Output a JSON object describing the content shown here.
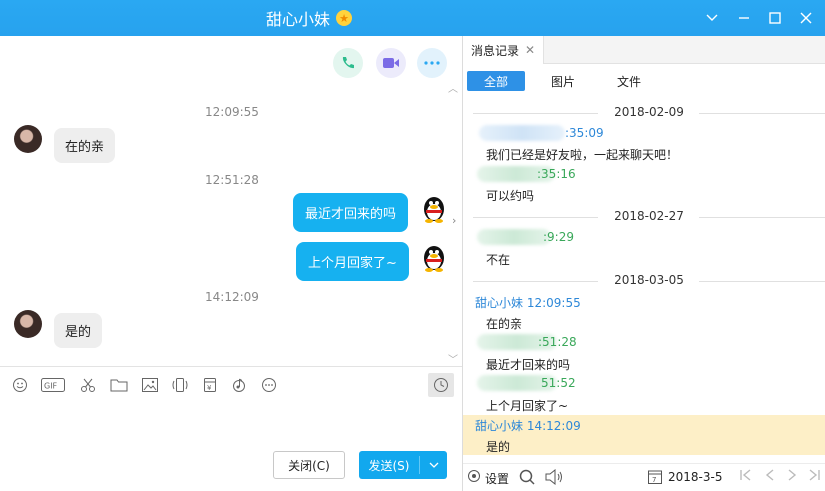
{
  "window": {
    "title": "甜心小妹",
    "badge_icon": "star-badge-icon",
    "controls": [
      "chevron-down-icon",
      "minimize-icon",
      "maximize-icon",
      "close-icon"
    ]
  },
  "chat": {
    "call_buttons": [
      {
        "icon": "phone-icon",
        "color": "#2ebc8e"
      },
      {
        "icon": "video-icon",
        "color": "#7b6be6"
      },
      {
        "icon": "more-icon",
        "color": "#2aa8f2"
      }
    ],
    "messages": [
      {
        "type": "time",
        "text": "12:09:55"
      },
      {
        "type": "in",
        "text": "在的亲"
      },
      {
        "type": "time",
        "text": "12:51:28"
      },
      {
        "type": "out",
        "text": "最近才回来的吗"
      },
      {
        "type": "out",
        "text": "上个月回家了~"
      },
      {
        "type": "time",
        "text": "14:12:09"
      },
      {
        "type": "in",
        "text": "是的"
      }
    ],
    "toolbar_icons": [
      "emoji-icon",
      "gif-icon",
      "scissors-icon",
      "folder-icon",
      "image-icon",
      "shake-icon",
      "red-packet-icon",
      "music-icon",
      "more-circle-icon"
    ],
    "history_button_icon": "clock-icon",
    "close_button": "关闭(C)",
    "send_button": "发送(S)"
  },
  "history": {
    "tab_label": "消息记录",
    "filters": [
      "全部",
      "图片",
      "文件"
    ],
    "active_filter": "全部",
    "entries": [
      {
        "kind": "date",
        "text": "2018-02-09"
      },
      {
        "kind": "header",
        "sender": "",
        "time": ":35:09",
        "color": "#2e88d8"
      },
      {
        "kind": "msg",
        "text": "我们已经是好友啦，一起来聊天吧！"
      },
      {
        "kind": "header",
        "sender": "",
        "time": ":35:16",
        "color": "#3aa85a"
      },
      {
        "kind": "msg",
        "text": "可以约吗"
      },
      {
        "kind": "date",
        "text": "2018-02-27"
      },
      {
        "kind": "header",
        "sender": "",
        "time": ":9:29",
        "color": "#3aa85a"
      },
      {
        "kind": "msg",
        "text": "不在"
      },
      {
        "kind": "date",
        "text": "2018-03-05"
      },
      {
        "kind": "header",
        "sender": "甜心小妹",
        "time": "12:09:55",
        "color": "#2e88d8"
      },
      {
        "kind": "msg",
        "text": "在的亲"
      },
      {
        "kind": "header",
        "sender": "",
        "time": ":51:28",
        "color": "#3aa85a"
      },
      {
        "kind": "msg",
        "text": "最近才回来的吗"
      },
      {
        "kind": "header",
        "sender": "",
        "time": "51:52",
        "color": "#3aa85a"
      },
      {
        "kind": "msg",
        "text": "上个月回家了~"
      },
      {
        "kind": "header",
        "sender": "甜心小妹",
        "time": "14:12:09",
        "color": "#2e88d8"
      },
      {
        "kind": "msg",
        "text": "是的"
      }
    ],
    "settings_label": "设置",
    "date_value": "2018-3-5"
  }
}
